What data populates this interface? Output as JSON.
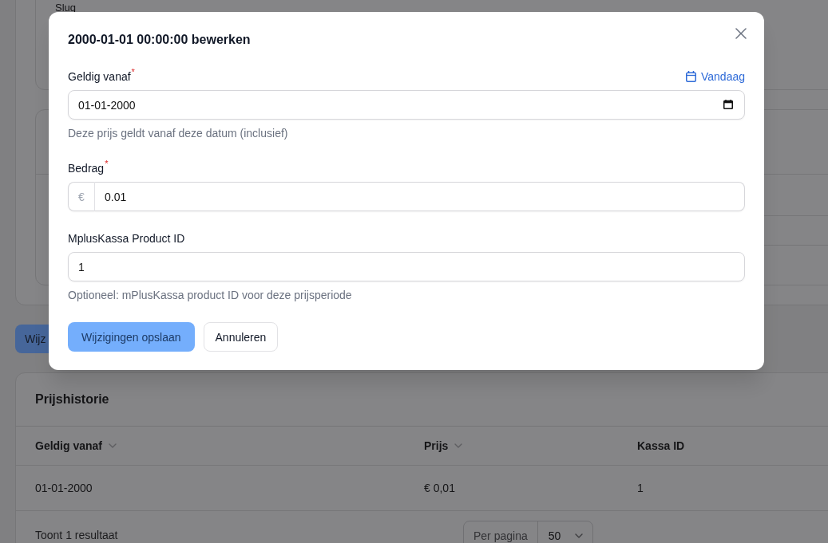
{
  "background": {
    "section": {
      "field_label": "Slug"
    },
    "save_button": "Wijz"
  },
  "dialog": {
    "title": "2000-01-01 00:00:00 bewerken",
    "fields": [
      {
        "kind": "date",
        "label": "Geldig vanaf",
        "required_mark": "*",
        "action": "Vandaag",
        "value": "01-01-2000",
        "hint": "Deze prijs geldt vanaf deze datum (inclusief)"
      },
      {
        "kind": "currency",
        "label": "Bedrag",
        "required_mark": "*",
        "prefix": "€",
        "value": "0.01"
      },
      {
        "kind": "text",
        "label": "MplusKassa Product ID",
        "value": "1",
        "hint": "Optioneel: mPlusKassa product ID voor deze prijsperiode"
      }
    ],
    "buttons": [
      {
        "label": "Wijzigingen opslaan",
        "kind": "primary"
      },
      {
        "label": "Annuleren",
        "kind": "secondary"
      }
    ]
  },
  "price_history": {
    "title": "Prijshistorie",
    "columns": [
      {
        "label": "Geldig vanaf",
        "sortable": true
      },
      {
        "label": "Prijs",
        "sortable": true
      },
      {
        "label": "Kassa ID",
        "sortable": false
      }
    ],
    "rows": [
      [
        "01-01-2000",
        "€ 0,01",
        "1"
      ]
    ],
    "footer": {
      "results": "Toont 1 resultaat",
      "per_page": {
        "label": "Per pagina",
        "value": "50"
      }
    }
  }
}
